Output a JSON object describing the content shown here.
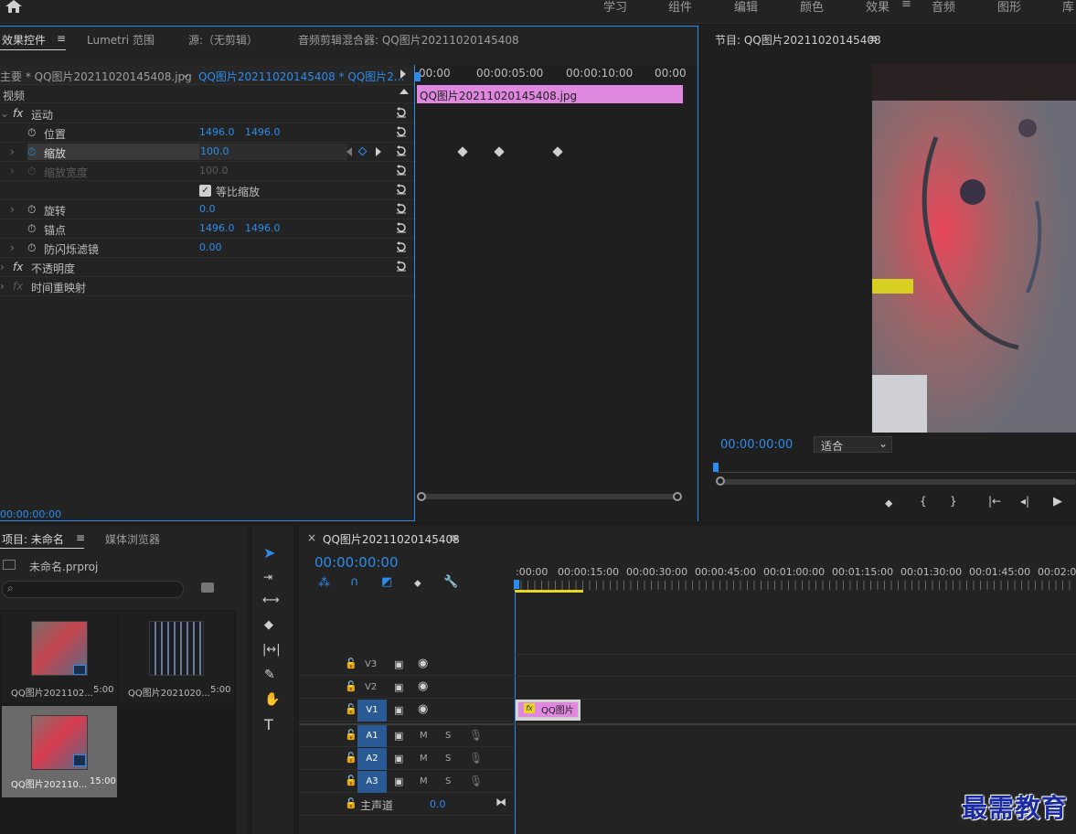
{
  "workspaces": [
    "学习",
    "组件",
    "编辑",
    "颜色",
    "效果",
    "音频",
    "图形",
    "库"
  ],
  "effect_controls": {
    "tabs": [
      "效果控件",
      "Lumetri 范围",
      "源:（无剪辑）",
      "音频剪辑混合器: QQ图片20211020145408"
    ],
    "menu_glyph": "≡",
    "master": "主要 * QQ图片20211020145408.jpg",
    "clip": "QQ图片20211020145408 * QQ图片2...",
    "section_video": "视频",
    "fx": "fx",
    "motion": "运动",
    "position_label": "位置",
    "position_x": "1496.0",
    "position_y": "1496.0",
    "scale_label": "缩放",
    "scale_value": "100.0",
    "scale_width_label": "缩放宽度",
    "scale_width_value": "100.0",
    "uniform_scale": "等比缩放",
    "rotation_label": "旋转",
    "rotation_value": "0.0",
    "anchor_label": "锚点",
    "anchor_x": "1496.0",
    "anchor_y": "1496.0",
    "flicker_label": "防闪烁滤镜",
    "flicker_value": "0.00",
    "opacity": "不透明度",
    "time_remap": "时间重映射",
    "ruler": [
      "00:00",
      "00:00:05:00",
      "00:00:10:00",
      "00:00"
    ],
    "clip_bar": "QQ图片20211020145408.jpg",
    "timecode": "00:00:00:00"
  },
  "program": {
    "title": "节目: QQ图片20211020145408",
    "timecode": "00:00:00:00",
    "fit": "适合"
  },
  "project": {
    "tabs": [
      "项目: 未命名",
      "媒体浏览器"
    ],
    "file": "未命名.prproj",
    "items": [
      {
        "name": "QQ图片2021102...",
        "dur": "5:00"
      },
      {
        "name": "QQ图片2021020...",
        "dur": "5:00"
      },
      {
        "name": "QQ图片202110...",
        "dur": "15:00"
      }
    ]
  },
  "timeline": {
    "tab": "QQ图片20211020145408",
    "close": "×",
    "timecode": "00:00:00:00",
    "ruler": [
      ":00:00",
      "00:00:15:00",
      "00:00:30:00",
      "00:00:45:00",
      "00:01:00:00",
      "00:01:15:00",
      "00:01:30:00",
      "00:01:45:00",
      "00:02:00"
    ],
    "tracks_video": [
      "V3",
      "V2",
      "V1"
    ],
    "tracks_audio": [
      "A1",
      "A2",
      "A3"
    ],
    "mute": "M",
    "solo": "S",
    "master_label": "主声道",
    "master_value": "0.0",
    "clip": "QQ图片"
  },
  "watermark": "最需教育",
  "colors": {
    "accent": "#2d8ceb",
    "clip": "#e088e0",
    "track_btn": "#2a5a96"
  }
}
